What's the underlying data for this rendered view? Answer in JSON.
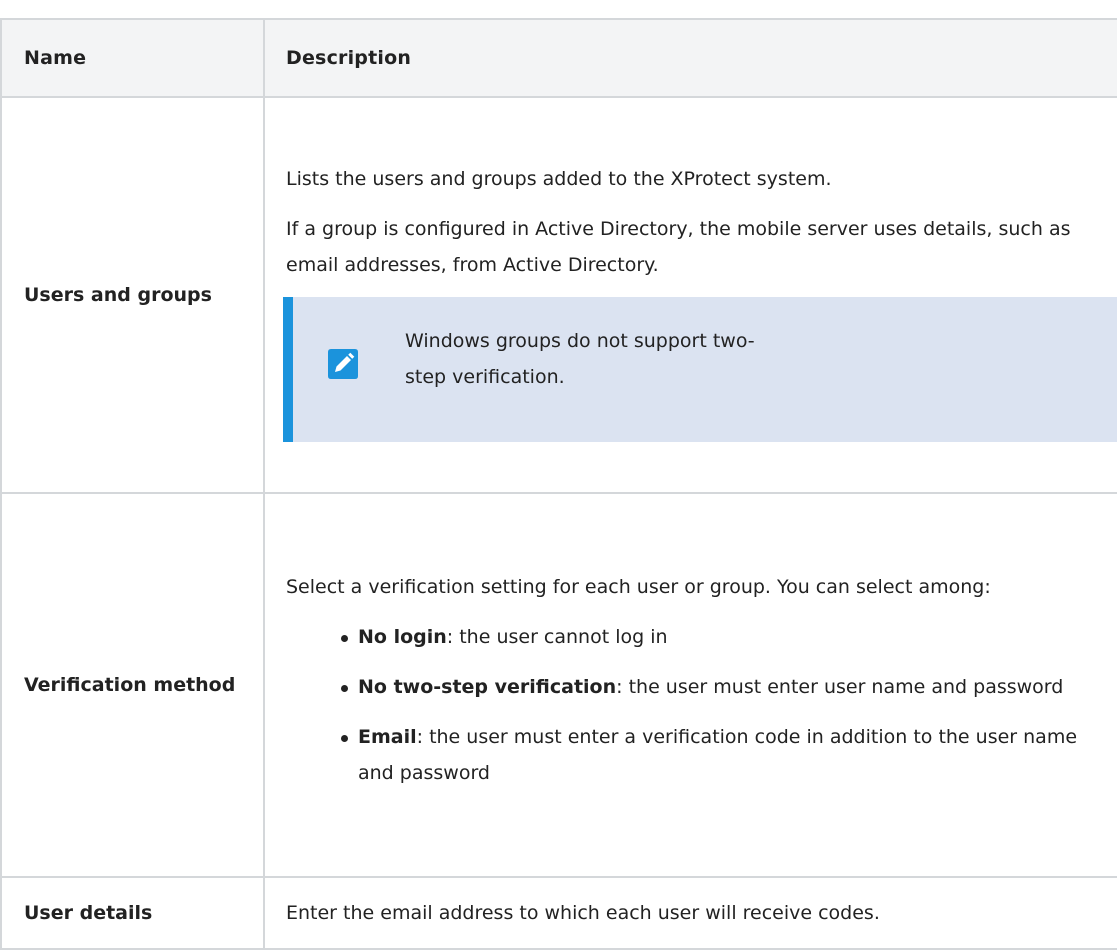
{
  "table": {
    "headers": {
      "name": "Name",
      "description": "Description"
    },
    "rows": [
      {
        "name": "Users and groups",
        "paragraphs": [
          "Lists the users and groups added to the XProtect system.",
          "If a group is configured in Active Directory, the mobile server uses details, such as email addresses, from Active Directory."
        ],
        "note": {
          "icon": "pencil-note-icon",
          "text": "Windows groups do not support two-step verification."
        }
      },
      {
        "name": "Verification method",
        "intro": "Select a verification setting for each user or group. You can select among:",
        "options": [
          {
            "term": "No login",
            "rest": ": the user cannot log in"
          },
          {
            "term": "No two-step verification",
            "rest": ": the user must enter user name and password"
          },
          {
            "term": "Email",
            "rest": ": the user must enter a verification code in addition to the user name and password"
          }
        ]
      },
      {
        "name": "User details",
        "paragraphs": [
          "Enter the email address to which each user will receive codes."
        ]
      }
    ]
  },
  "colors": {
    "note_background": "#dbe3f1",
    "note_accent": "#1b93dc",
    "border": "#d4d7da",
    "header_background": "#f3f4f5"
  }
}
